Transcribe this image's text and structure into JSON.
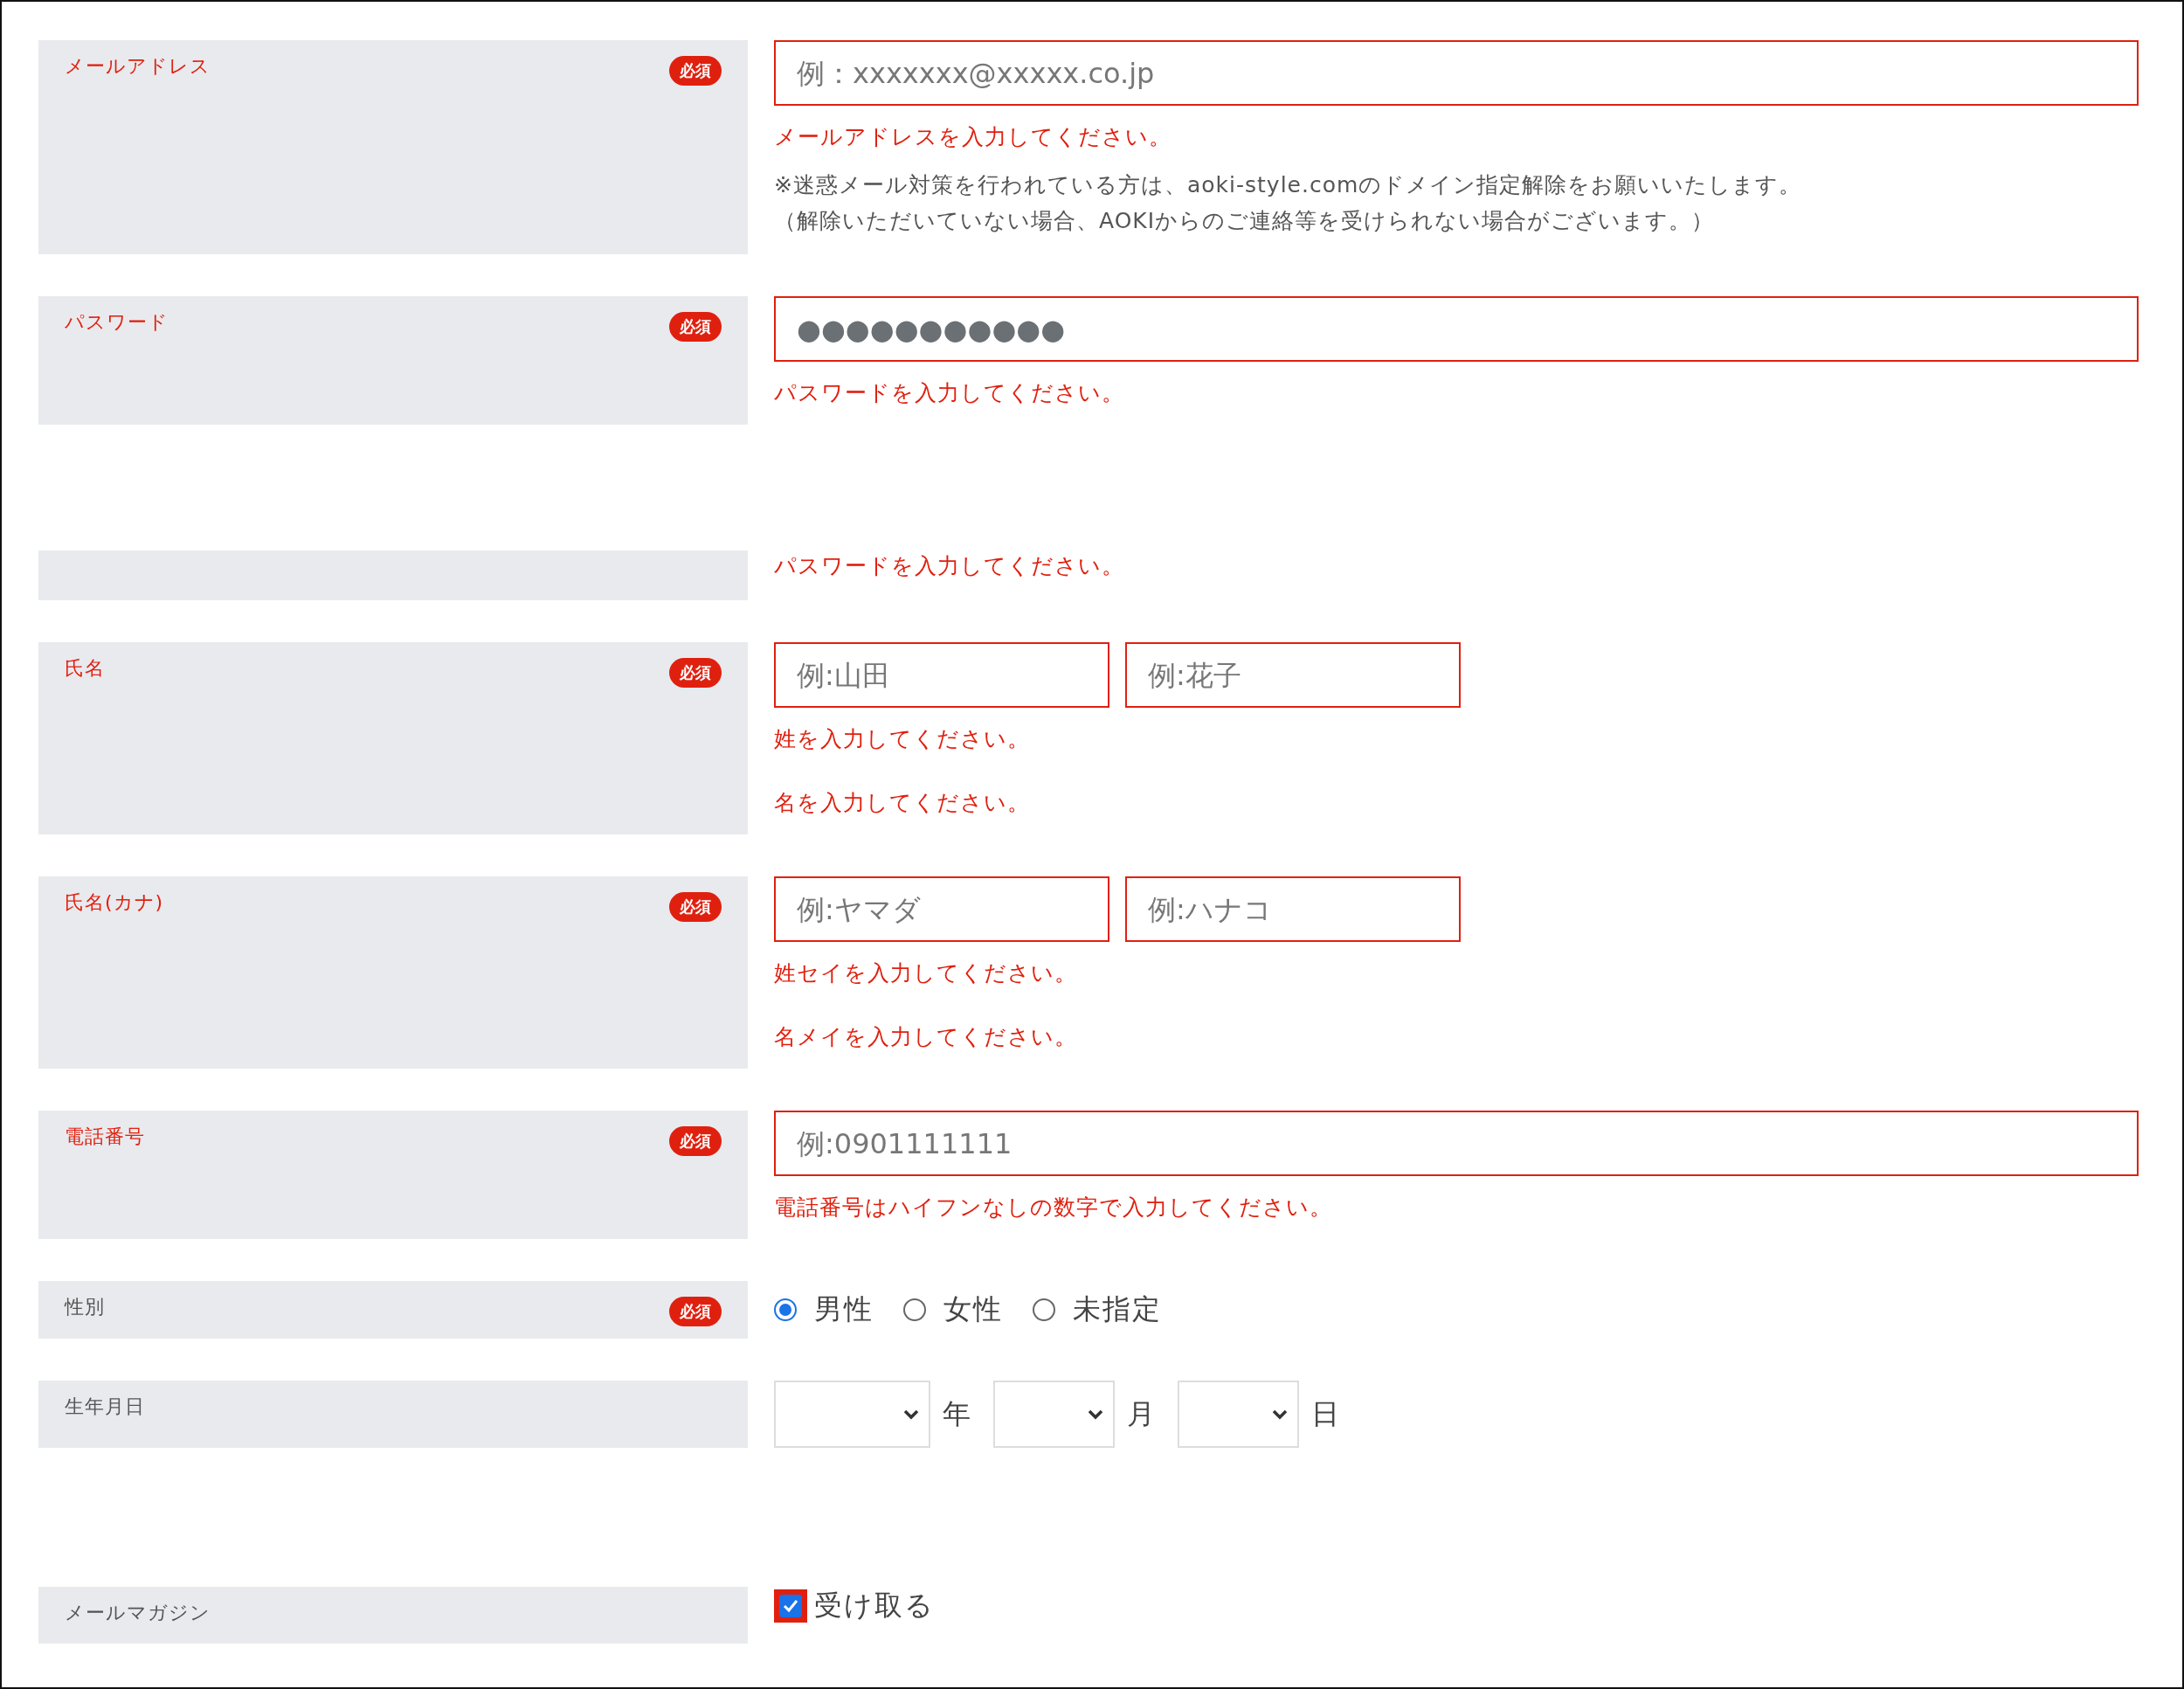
{
  "rows": [
    {
      "kind": "text",
      "label": "メールアドレス",
      "badge": "必須",
      "invalid": true,
      "fields": [
        {
          "placeholder": "例：xxxxxxx@xxxxx.co.jp"
        }
      ],
      "errors": [
        "メールアドレスを入力してください。"
      ],
      "notes": [
        "※迷惑メール対策を行われている方は、aoki-style.comのドメイン指定解除をお願いいたします。",
        "（解除いただいていない場合、AOKIからのご連絡等を受けられない場合がございます。）"
      ]
    },
    {
      "kind": "text",
      "label": "パスワード",
      "badge": "必須",
      "invalid": true,
      "fields": [
        {
          "value": "●●●●●●●●●●●"
        }
      ],
      "errors": [
        "パスワードを入力してください。"
      ]
    },
    {
      "kind": "message",
      "errors": [
        "パスワードを入力してください。"
      ]
    },
    {
      "kind": "text",
      "label": "氏名",
      "badge": "必須",
      "invalid": true,
      "fields": [
        {
          "placeholder": "例:山田"
        },
        {
          "placeholder": "例:花子"
        }
      ],
      "errors": [
        "姓を入力してください。",
        "名を入力してください。"
      ]
    },
    {
      "kind": "text",
      "label": "氏名(カナ)",
      "badge": "必須",
      "invalid": true,
      "fields": [
        {
          "placeholder": "例:ヤマダ"
        },
        {
          "placeholder": "例:ハナコ"
        }
      ],
      "errors": [
        "姓セイを入力してください。",
        "名メイを入力してください。"
      ]
    },
    {
      "kind": "text",
      "label": "電話番号",
      "badge": "必須",
      "invalid": true,
      "fields": [
        {
          "placeholder": "例:0901111111"
        }
      ],
      "errors": [
        "電話番号はハイフンなしの数字で入力してください。"
      ]
    },
    {
      "kind": "radio",
      "label": "性別",
      "badge": "必須",
      "invalid": false,
      "options": [
        {
          "label": "男性",
          "selected": true
        },
        {
          "label": "女性",
          "selected": false
        },
        {
          "label": "未指定",
          "selected": false
        }
      ]
    },
    {
      "kind": "date",
      "label": "生年月日",
      "invalid": false,
      "selects": [
        {
          "unit": "年"
        },
        {
          "unit": "月"
        },
        {
          "unit": "日"
        }
      ]
    },
    {
      "kind": "checkbox",
      "label": "メールマガジン",
      "invalid": false,
      "checkbox": {
        "label": "受け取る",
        "checked": true,
        "highlighted": true
      }
    }
  ]
}
